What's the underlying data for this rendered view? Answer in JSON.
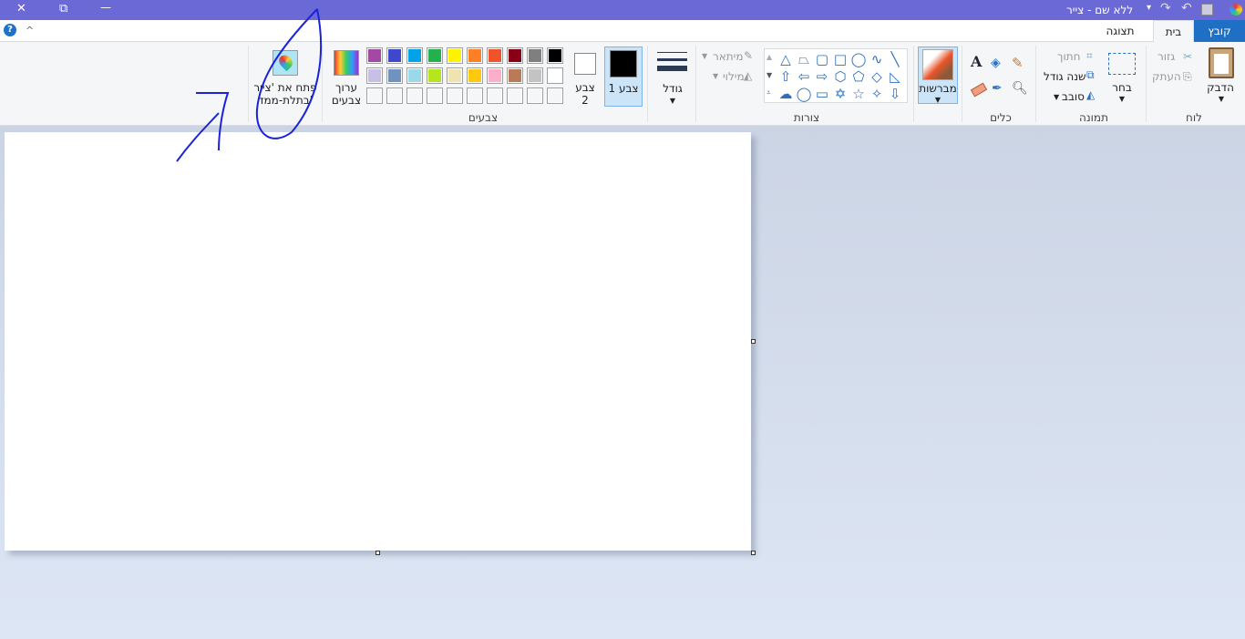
{
  "window": {
    "title": "ללא שם - צייר",
    "close": "✕",
    "restore": "⧉",
    "minimize": "—"
  },
  "tabs": [
    {
      "label": "קובץ"
    },
    {
      "label": "בית"
    },
    {
      "label": "תצוגה"
    }
  ],
  "help": "?",
  "collapse": "^",
  "clipboard": {
    "group": "לוח",
    "paste": "הדבק",
    "cut": "גזור",
    "copy": "העתק"
  },
  "image": {
    "group": "תמונה",
    "select": "בחר",
    "crop": "חתוך",
    "resize": "שנה גודל",
    "rotate": "סובב"
  },
  "tools": {
    "group": "כלים"
  },
  "brushes": {
    "label": "מברשות"
  },
  "shapes": {
    "group": "צורות",
    "outline": "מיתאר",
    "fill": "מילוי",
    "items": [
      "△",
      "⏢",
      "▢",
      "□",
      "◯",
      "∿",
      "╲",
      "⇧",
      "⇦",
      "⇨",
      "⬡",
      "⬠",
      "◇",
      "◺",
      "☁",
      "◯",
      "▭",
      "✡",
      "☆",
      "✧",
      "⇩"
    ]
  },
  "size": {
    "label": "גודל"
  },
  "colors": {
    "group": "צבעים",
    "color1": "צבע 1",
    "color2": "צבע 2",
    "edit": "ערוך צבעים",
    "row1": [
      "#a349a4",
      "#3f48cc",
      "#00a2e8",
      "#22b14c",
      "#fff200",
      "#ff7f27",
      "#f0522a",
      "#880015",
      "#7f7f7f",
      "#000000"
    ],
    "row2": [
      "#c8bfe7",
      "#7092be",
      "#99d9ea",
      "#b5e61d",
      "#efe4b0",
      "#ffc90e",
      "#ffaec9",
      "#b97a57",
      "#c3c3c3",
      "#ffffff"
    ],
    "primary": "#000000",
    "secondary": "#ffffff"
  },
  "paint3d": {
    "label": "פתח את 'צייר בתלת-ממד'"
  }
}
